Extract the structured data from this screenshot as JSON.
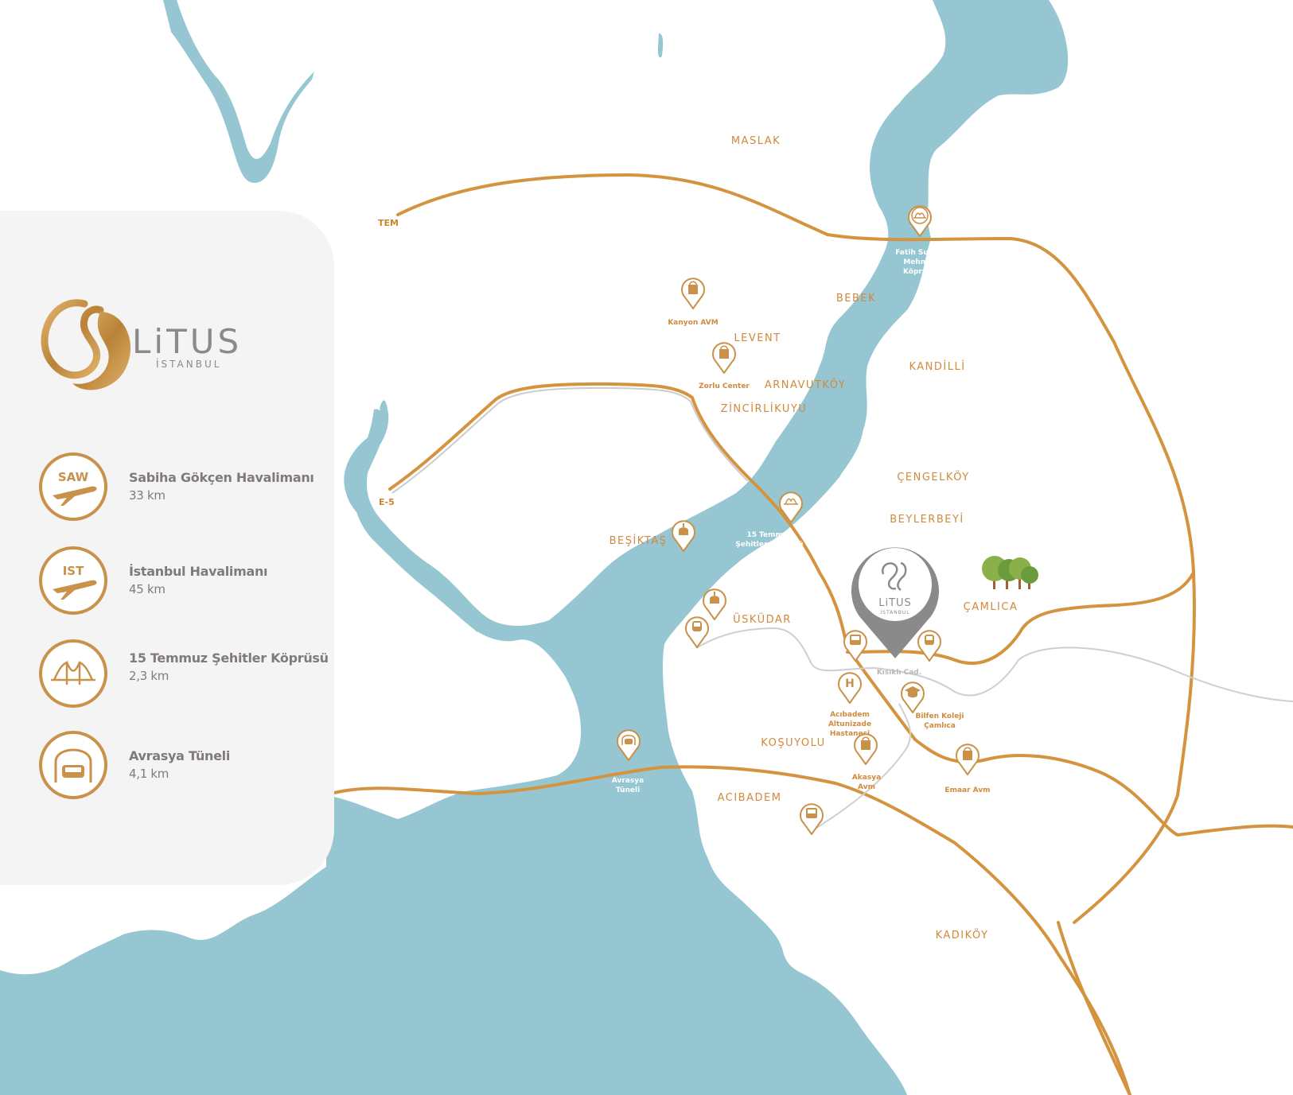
{
  "colors": {
    "water": "#95c6d2",
    "road": "#d4943f",
    "panel": "#f4f4f4",
    "accent": "#c9914a",
    "grey_road": "#cfcfcf",
    "marker": "#8a8a8a"
  },
  "brand": {
    "name": "LiTUS",
    "sub": "İSTANBUL"
  },
  "features": [
    {
      "icon": "airplane-icon",
      "badge": "SAW",
      "title": "Sabiha Gökçen Havalimanı",
      "distance": "33 km"
    },
    {
      "icon": "airplane-icon",
      "badge": "IST",
      "title": "İstanbul Havalimanı",
      "distance": "45 km"
    },
    {
      "icon": "bridge-icon",
      "badge": "",
      "title": "15 Temmuz Şehitler Köprüsü",
      "distance": "2,3 km"
    },
    {
      "icon": "car-tunnel-icon",
      "badge": "",
      "title": "Avrasya Tüneli",
      "distance": "4,1 km"
    }
  ],
  "districts": [
    "MASLAK",
    "BEBEK",
    "LEVENT",
    "KANDİLLİ",
    "ARNAVUTKÖY",
    "ZİNCİRLİKUYU",
    "ÇENGELKÖY",
    "BEYLERBEYİ",
    "BEŞİKTAŞ",
    "ÇAMLICA",
    "ÜSKÜDAR",
    "KOŞUYOLU",
    "ACIBADEM",
    "KADIKÖY"
  ],
  "roads": [
    "TEM",
    "E-5"
  ],
  "pois": [
    {
      "icon": "bridge-icon",
      "label": "Fatih Sultan\nMehmet\nKöprüsü"
    },
    {
      "icon": "shopping-bag-icon",
      "label": "Kanyon AVM"
    },
    {
      "icon": "shopping-bag-icon",
      "label": "Zorlu Center"
    },
    {
      "icon": "bridge-icon",
      "label": "15 Temmuz\nŞehitler Köprüsü"
    },
    {
      "icon": "mosque-icon",
      "label": ""
    },
    {
      "icon": "mosque-icon",
      "label": ""
    },
    {
      "icon": "train-icon",
      "label": ""
    },
    {
      "icon": "bus-icon",
      "label": ""
    },
    {
      "icon": "train-icon",
      "label": ""
    },
    {
      "icon": "hospital-icon",
      "label": "Acıbadem\nAltunizade\nHastanesi"
    },
    {
      "icon": "graduation-cap-icon",
      "label": "Bilfen Koleji\nÇamlıca"
    },
    {
      "icon": "car-tunnel-icon",
      "label": "Avrasya\nTüneli"
    },
    {
      "icon": "shopping-bag-icon",
      "label": "Akasya\nAvm"
    },
    {
      "icon": "shopping-bag-icon",
      "label": "Emaar Avm"
    },
    {
      "icon": "bus-icon",
      "label": ""
    }
  ],
  "street": "Kısıklı Cad.",
  "park": {
    "icon": "trees-icon"
  }
}
